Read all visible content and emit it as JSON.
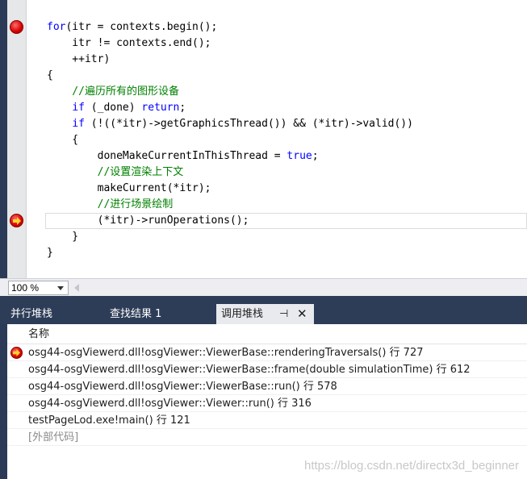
{
  "editor": {
    "code_lines": [
      [
        {
          "t": "for",
          "c": "kw"
        },
        {
          "t": "(itr = contexts.begin();",
          "c": ""
        }
      ],
      [
        {
          "t": "    itr != contexts.end();",
          "c": ""
        }
      ],
      [
        {
          "t": "    ++itr)",
          "c": ""
        }
      ],
      [
        {
          "t": "{",
          "c": ""
        }
      ],
      [
        {
          "t": "    //遍历所有的图形设备",
          "c": "cm"
        }
      ],
      [
        {
          "t": "    ",
          "c": ""
        },
        {
          "t": "if",
          "c": "kw"
        },
        {
          "t": " (_done) ",
          "c": ""
        },
        {
          "t": "return",
          "c": "kw"
        },
        {
          "t": ";",
          "c": ""
        }
      ],
      [
        {
          "t": "    ",
          "c": ""
        },
        {
          "t": "if",
          "c": "kw"
        },
        {
          "t": " (!((*itr)->getGraphicsThread()) && (*itr)->valid())",
          "c": ""
        }
      ],
      [
        {
          "t": "    {",
          "c": ""
        }
      ],
      [
        {
          "t": "        doneMakeCurrentInThisThread = ",
          "c": ""
        },
        {
          "t": "true",
          "c": "kw"
        },
        {
          "t": ";",
          "c": ""
        }
      ],
      [
        {
          "t": "        //设置渲染上下文",
          "c": "cm"
        }
      ],
      [
        {
          "t": "        makeCurrent(*itr);",
          "c": ""
        }
      ],
      [
        {
          "t": "        //进行场景绘制",
          "c": "cm"
        }
      ],
      [
        {
          "t": "        (*itr)->runOperations();",
          "c": ""
        }
      ],
      [
        {
          "t": "    }",
          "c": ""
        }
      ],
      [
        {
          "t": "}",
          "c": ""
        }
      ]
    ],
    "current_line_index": 12
  },
  "zoom": {
    "value": "100 %"
  },
  "tabs": {
    "parallel_stacks": "并行堆栈",
    "find_results": "查找结果 1",
    "call_stack": "调用堆栈",
    "pin": "⊣",
    "close": "✕"
  },
  "call_stack": {
    "header": "名称",
    "rows": [
      "osg44-osgViewerd.dll!osgViewer::ViewerBase::renderingTraversals() 行 727",
      "osg44-osgViewerd.dll!osgViewer::ViewerBase::frame(double simulationTime) 行 612",
      "osg44-osgViewerd.dll!osgViewer::ViewerBase::run() 行 578",
      "osg44-osgViewerd.dll!osgViewer::Viewer::run() 行 316",
      "testPageLod.exe!main() 行 121",
      "[外部代码]"
    ]
  },
  "watermark": "https://blog.csdn.net/directx3d_beginner",
  "colors": {
    "keyword": "#0000ff",
    "comment": "#008000",
    "panel_header": "#2d3c57",
    "breakpoint": "#d40000"
  }
}
